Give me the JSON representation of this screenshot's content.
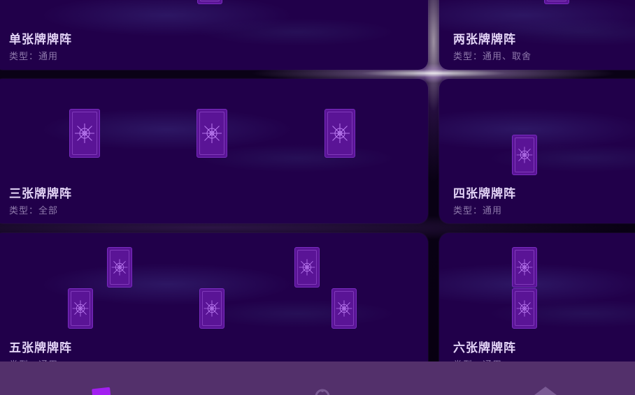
{
  "spreads": [
    {
      "title": "单张牌牌阵",
      "type": "类型：通用"
    },
    {
      "title": "两张牌牌阵",
      "type": "类型：通用、取舍"
    },
    {
      "title": "三张牌牌阵",
      "type": "类型：全部"
    },
    {
      "title": "四张牌牌阵",
      "type": "类型：通用"
    },
    {
      "title": "五张牌牌阵",
      "type": "类型：通用"
    },
    {
      "title": "六张牌牌阵",
      "type": "类型：通用"
    }
  ],
  "nav": {
    "items": [
      {
        "icon": "cards-icon",
        "active": true
      },
      {
        "icon": "crystal-ball-icon",
        "active": false
      },
      {
        "icon": "diamond-icon",
        "active": false
      }
    ],
    "active_color": "#a21ff0",
    "inactive_color": "#7a5a94"
  },
  "colors": {
    "card_bg": "#21004a",
    "tarot_back": "#5a1496",
    "title": "#e3d4f6",
    "subtitle": "#8f7aac",
    "nav_bg": "#53306b"
  }
}
